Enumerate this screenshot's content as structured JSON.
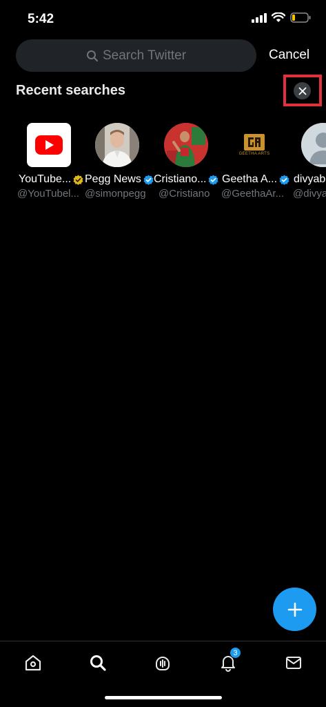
{
  "status_bar": {
    "time": "5:42"
  },
  "search": {
    "placeholder": "Search Twitter",
    "cancel_label": "Cancel"
  },
  "recent": {
    "title": "Recent searches",
    "items": [
      {
        "name": "YouTube...",
        "handle": "@YouTubel...",
        "verified": "gold"
      },
      {
        "name": "Pegg News",
        "handle": "@simonpegg",
        "verified": "blue"
      },
      {
        "name": "Cristiano...",
        "handle": "@Cristiano",
        "verified": "blue"
      },
      {
        "name": "Geetha A...",
        "handle": "@GeethaAr...",
        "verified": "blue"
      },
      {
        "name": "divyab",
        "handle": "@divya",
        "verified": "none"
      }
    ],
    "geetha_logo_text": "GEETHA ARTS"
  },
  "tabs": {
    "notifications_badge": "3"
  },
  "colors": {
    "accent": "#1d9bf0",
    "background": "#000000",
    "highlight": "#e0313d",
    "gold": "#e2b719"
  }
}
